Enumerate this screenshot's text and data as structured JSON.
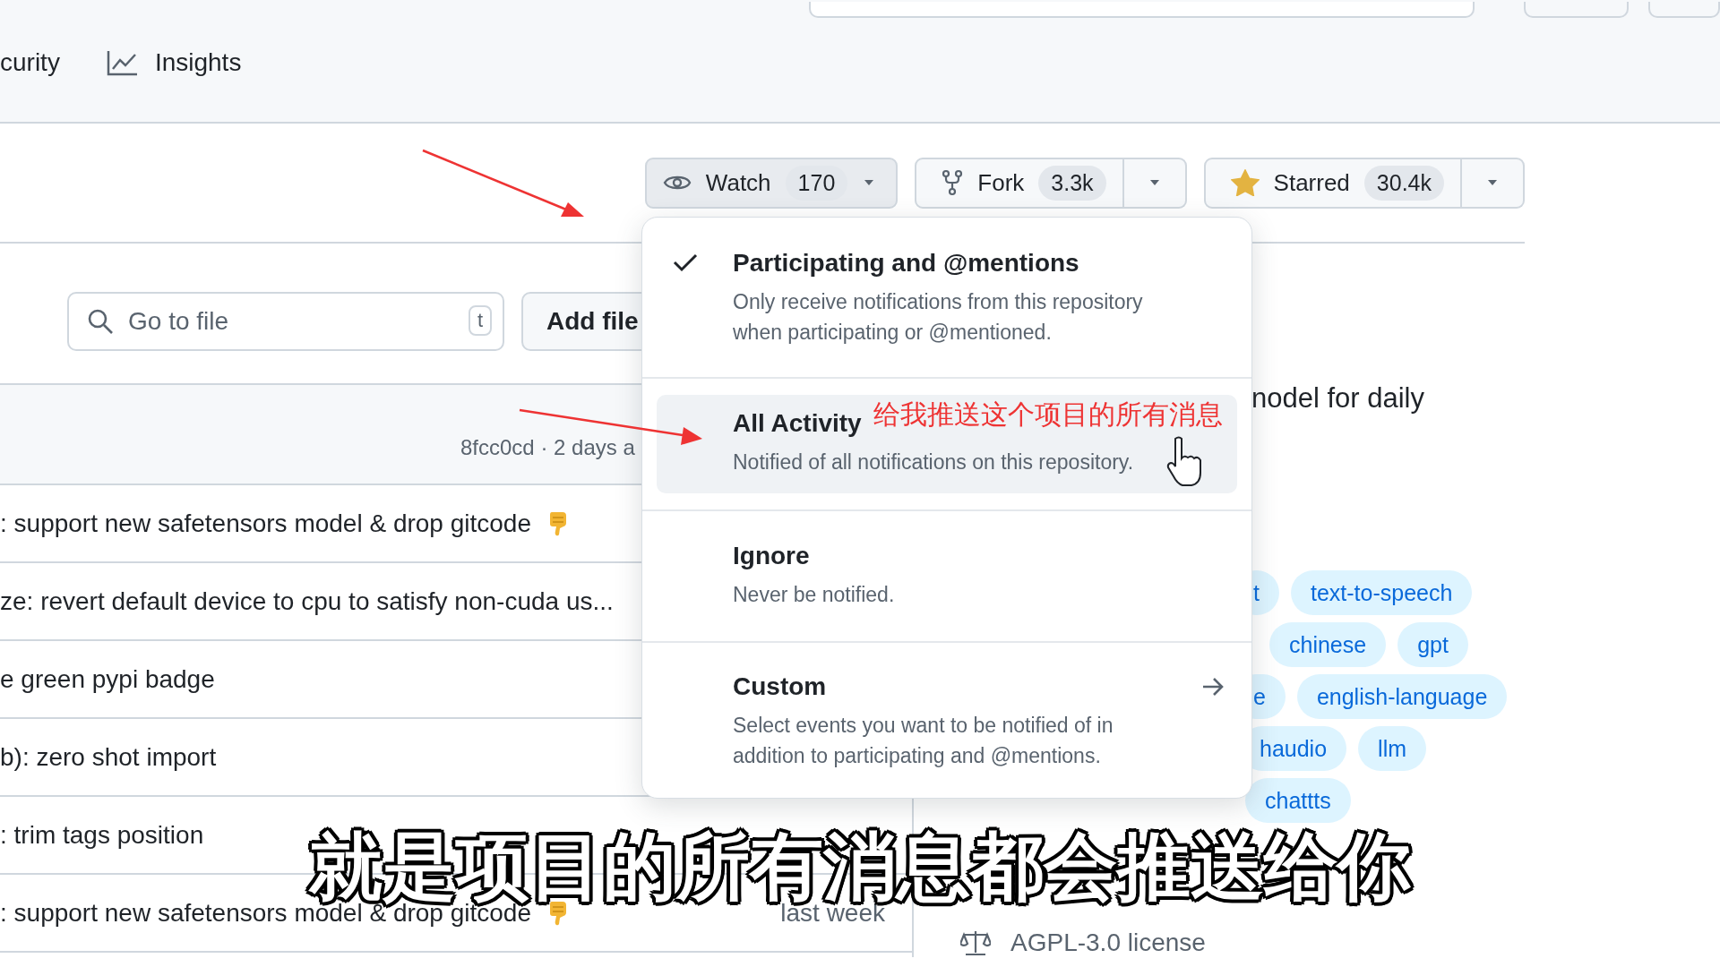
{
  "nav_tabs": [
    {
      "label": "curity",
      "kind": "text",
      "selected": false
    },
    {
      "label": "Insights",
      "kind": "chart",
      "selected": false
    }
  ],
  "repo_actions": {
    "watch": {
      "label": "Watch",
      "count": "170",
      "open": true
    },
    "fork": {
      "label": "Fork",
      "count": "3.3k"
    },
    "star": {
      "label": "Starred",
      "count": "30.4k",
      "starred": true
    }
  },
  "file_search": {
    "placeholder": "Go to file",
    "shortcut": "t"
  },
  "add_file_button": "Add file",
  "latest_commit": {
    "meta": "8fcc0cd · 2 days a"
  },
  "commits": [
    {
      "message": ": support new safetensors model & drop gitcode",
      "emoji": true
    },
    {
      "message": "ze: revert default device to cpu to satisfy non-cuda us...",
      "emoji": false
    },
    {
      "message": "e green pypi badge",
      "emoji": false
    },
    {
      "message": "b): zero shot import",
      "emoji": false
    },
    {
      "message": ": trim tags position",
      "emoji": false
    },
    {
      "message": ": support new safetensors model & drop gitcode",
      "emoji": true,
      "time": "last week"
    }
  ],
  "about": {
    "description": "nodel for daily",
    "topic_rows": [
      [
        "t",
        "text-to-speech"
      ],
      [
        "chinese",
        "gpt"
      ],
      [
        "e",
        "english-language"
      ],
      [
        "haudio",
        "llm"
      ],
      [
        "chattts"
      ]
    ],
    "license": "AGPL-3.0 license"
  },
  "watch_menu": {
    "items": [
      {
        "title": "Participating and @mentions",
        "description": "Only receive notifications from this repository when participating or @mentioned.",
        "selected": true,
        "highlighted": false,
        "kind": "option"
      },
      {
        "title": "All Activity",
        "description": "Notified of all notifications on this repository.",
        "selected": false,
        "highlighted": true,
        "kind": "option"
      },
      {
        "title": "Ignore",
        "description": "Never be notified.",
        "selected": false,
        "highlighted": false,
        "kind": "option"
      },
      {
        "title": "Custom",
        "description": "Select events you want to be notified of in addition to participating and @mentions.",
        "selected": false,
        "highlighted": false,
        "kind": "submenu"
      }
    ]
  },
  "annotation": {
    "note": "给我推送这个项目的所有消息"
  },
  "subtitle": "就是项目的所有消息都会推送给你"
}
